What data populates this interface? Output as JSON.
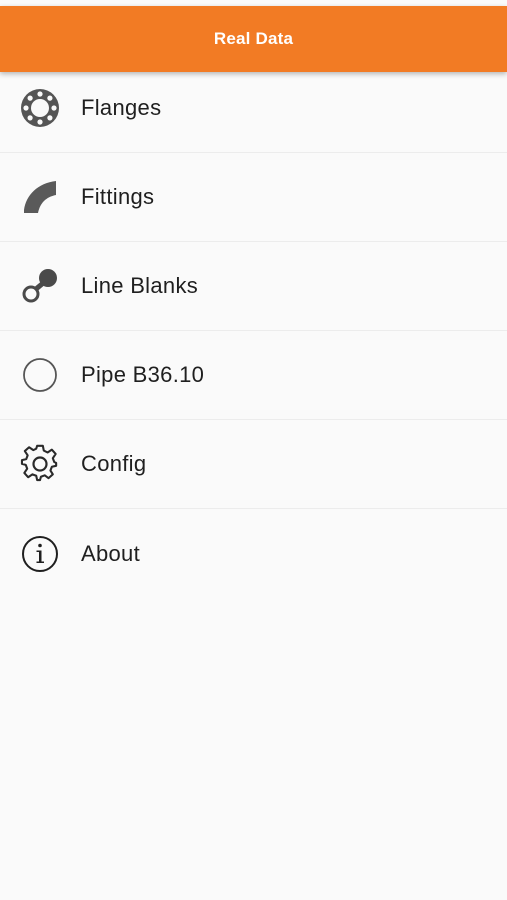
{
  "app_bar": {
    "title": "Real Data",
    "color": "#f27b24"
  },
  "menu": {
    "items": [
      {
        "label": "Flanges",
        "icon": "flange-icon"
      },
      {
        "label": "Fittings",
        "icon": "elbow-fitting-icon"
      },
      {
        "label": "Line Blanks",
        "icon": "line-blank-icon"
      },
      {
        "label": "Pipe B36.10",
        "icon": "pipe-circle-icon"
      },
      {
        "label": "Config",
        "icon": "gear-icon"
      },
      {
        "label": "About",
        "icon": "info-icon"
      }
    ]
  }
}
